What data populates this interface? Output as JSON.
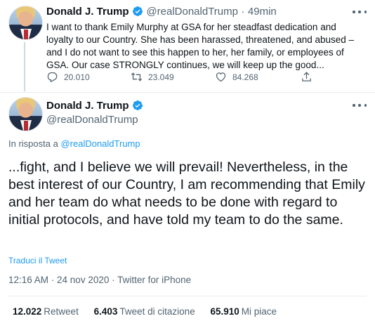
{
  "tweet1": {
    "author_name": "Donald J. Trump",
    "handle": "@realDonaldTrump",
    "separator": "·",
    "time": "49min",
    "text": "I want to thank Emily Murphy at GSA for her steadfast dedication and loyalty to our Country. She has been harassed, threatened, and abused – and I do not want to see this happen to her, her family, or employees of GSA. Our case STRONGLY continues, we will keep up the good...",
    "replies": "20.010",
    "retweets": "23.049",
    "likes": "84.268",
    "icons": [
      "reply-icon",
      "retweet-icon",
      "like-icon",
      "share-icon",
      "more-icon",
      "verified-icon"
    ]
  },
  "tweet2": {
    "author_name": "Donald J. Trump",
    "handle": "@realDonaldTrump",
    "reply_prefix": "In risposta a",
    "reply_to": "@realDonaldTrump",
    "text": "...fight, and I believe we will prevail! Nevertheless, in the best interest of our Country, I am recommending that Emily and her team do what needs to be done with regard to initial protocols, and have told my team to do the same.",
    "translate_label": "Traduci il Tweet",
    "timestamp": "12:16 AM · 24 nov 2020 · Twitter for iPhone",
    "stats": {
      "retweets_count": "12.022",
      "retweets_label": "Retweet",
      "quotes_count": "6.403",
      "quotes_label": "Tweet di citazione",
      "likes_count": "65.910",
      "likes_label": "Mi piace"
    }
  },
  "colors": {
    "accent": "#1d9bf0",
    "secondary_text": "#536471",
    "divider": "#e6ecf0"
  }
}
